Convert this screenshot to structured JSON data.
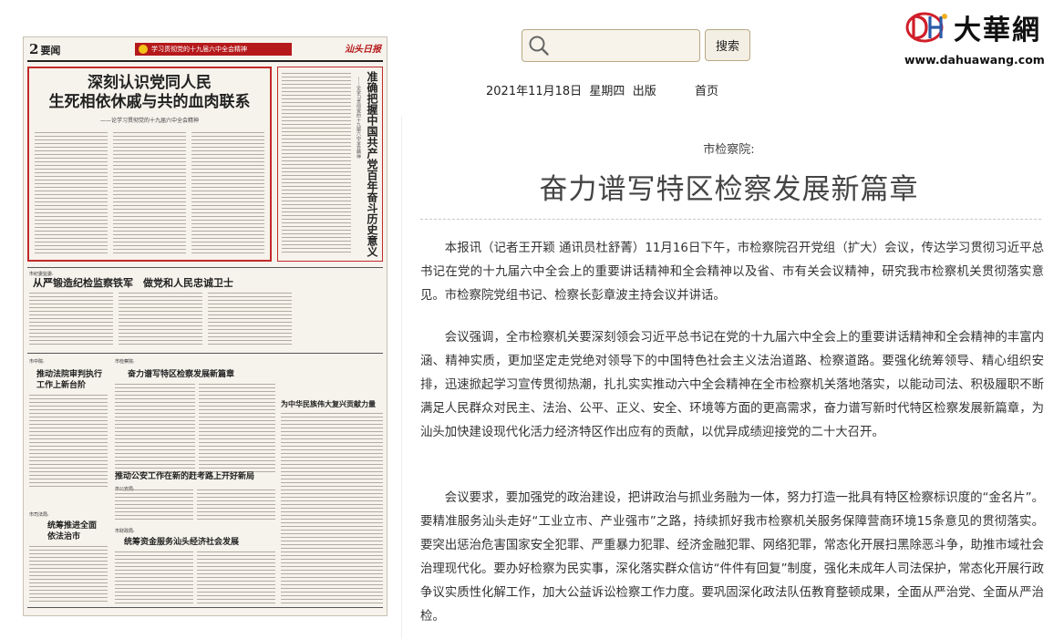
{
  "newspaper_page": {
    "page_number": "2",
    "section": "要闻",
    "masthead_logo": "汕头日报",
    "banner": "学习贯彻党的十九届六中全会精神",
    "lead_title_line1": "深刻认识党同人民",
    "lead_title_line2": "生死相依休戚与共的血肉联系",
    "lead_subtitle": "——论学习贯彻党的十九届六中全会精神",
    "side_title": "准确把握中国共产党百年奋斗历史意义",
    "side_subtitle": "——论学习贯彻党的十九届六中全会精神",
    "stories": [
      {
        "kicker": "市纪委监委:",
        "title": "从严锻造纪检监察铁军　做党和人民忠诚卫士"
      },
      {
        "kicker": "市中院:",
        "title": "推动法院审判执行工作上新台阶"
      },
      {
        "kicker": "市检察院:",
        "title": "奋力谱写特区检察发展新篇章"
      },
      {
        "kicker": "",
        "title": "为中华民族伟大复兴贡献力量"
      },
      {
        "kicker": "市公安局:",
        "title": "推动公安工作在新的赶考路上开好新局"
      },
      {
        "kicker": "市司法局:",
        "title": "统筹推进全面依法治市"
      },
      {
        "kicker": "市财政局:",
        "title": "统筹资金服务汕头经济社会发展"
      }
    ]
  },
  "search": {
    "placeholder": "",
    "button_label": "搜索"
  },
  "issue": {
    "date_line": "2021年11月18日  星期四  出版",
    "home_link": "首页"
  },
  "site": {
    "logo_text": "大華網",
    "url": "www.dahuawang.com"
  },
  "article": {
    "kicker": "市检察院:",
    "title": "奋力谱写特区检察发展新篇章",
    "paragraphs": [
      "本报讯（记者王开颖 通讯员杜舒菁）11月16日下午，市检察院召开党组（扩大）会议，传达学习贯彻习近平总书记在党的十九届六中全会上的重要讲话精神和全会精神以及省、市有关会议精神，研究我市检察机关贯彻落实意见。市检察院党组书记、检察长彭章波主持会议并讲话。",
      "会议强调，全市检察机关要深刻领会习近平总书记在党的十九届六中全会上的重要讲话精神和全会精神的丰富内涵、精神实质，更加坚定走党绝对领导下的中国特色社会主义法治道路、检察道路。要强化统筹领导、精心组织安排，迅速掀起学习宣传贯彻热潮，扎扎实实推动六中全会精神在全市检察机关落地落实，以能动司法、积极履职不断满足人民群众对民主、法治、公平、正义、安全、环境等方面的更高需求，奋力谱写新时代特区检察发展新篇章，为汕头加快建设现代化活力经济特区作出应有的贡献，以优异成绩迎接党的二十大召开。",
      "会议要求，要加强党的政治建设，把讲政治与抓业务融为一体，努力打造一批具有特区检察标识度的“金名片”。要精准服务汕头走好“工业立市、产业强市”之路，持续抓好我市检察机关服务保障营商环境15条意见的贯彻落实。要突出惩治危害国家安全犯罪、严重暴力犯罪、经济金融犯罪、网络犯罪，常态化开展扫黑除恶斗争，助推市域社会治理现代化。要办好检察为民实事，深化落实群众信访“件件有回复”制度，强化未成年人司法保护，常态化开展行政争议实质性化解工作，加大公益诉讼检察工作力度。要巩固深化政法队伍教育整顿成果，全面从严治党、全面从严治检。"
    ]
  },
  "colors": {
    "newspaper_red": "#b5191b",
    "search_border": "#b8a783",
    "logo_red": "#d01f2a"
  }
}
